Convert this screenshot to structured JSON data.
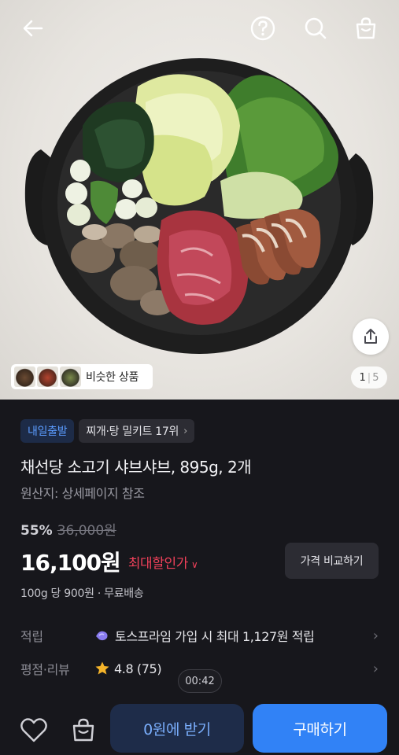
{
  "header": {
    "icons": [
      "back-arrow-icon",
      "help-icon",
      "search-icon",
      "shopping-bag-icon"
    ]
  },
  "gallery": {
    "current": "1",
    "total": "5",
    "similar_label": "비슷한 상품",
    "share_icon": "share-icon"
  },
  "product": {
    "tags": [
      {
        "label": "내일출발"
      },
      {
        "label": "찌개·탕 밀키트 17위"
      }
    ],
    "title": "채선당 소고기 샤브샤브, 895g, 2개",
    "origin": "원산지: 상세페이지 참조",
    "discount": "55%",
    "original_price": "36,000원",
    "price": "16,100원",
    "max_discount_label": "최대할인가",
    "compare_label": "가격 비교하기",
    "unit_price": "100g 당 900원 · 무료배송"
  },
  "details": {
    "points_label": "적립",
    "points_value": "토스프라임 가입 시 최대 1,127원 적립",
    "rating_label": "평점·리뷰",
    "rating_value": "4.8 (75)"
  },
  "timer": "00:42",
  "bottom": {
    "coupon_label": "0원에 받기",
    "buy_label": "구매하기"
  },
  "colors": {
    "accent": "#3182f6",
    "sale_red": "#f0415a",
    "background": "#17171c",
    "star": "#f5b42a"
  }
}
